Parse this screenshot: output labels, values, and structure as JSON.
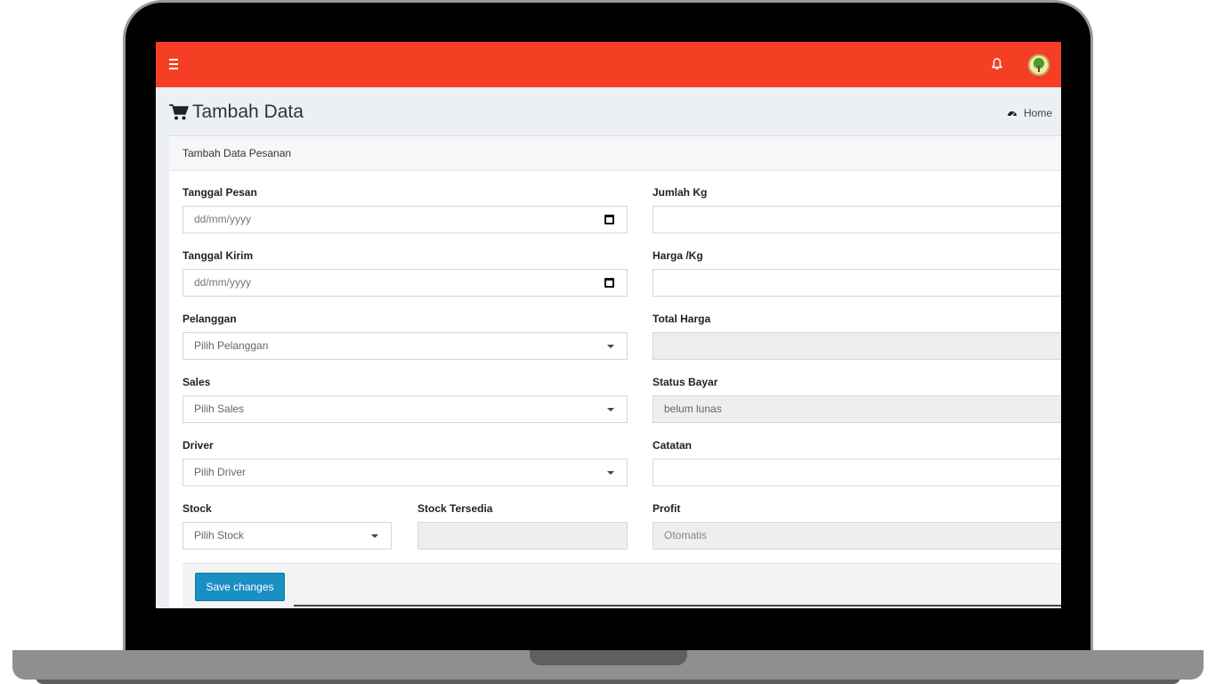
{
  "navbar": {
    "menu_icon": "hamburger-icon",
    "notification_icon": "bell-icon",
    "avatar_icon": "tree-logo-icon",
    "color": "#f43f25"
  },
  "header": {
    "title_icon": "shopping-cart-icon",
    "title": "Tambah Data",
    "breadcrumb_icon": "dashboard-icon",
    "breadcrumb": "Home"
  },
  "form": {
    "title": "Tambah Data Pesanan",
    "tanggal_pesan": {
      "label": "Tanggal Pesan",
      "value": "dd/mm/yyyy"
    },
    "tanggal_kirim": {
      "label": "Tanggal Kirim",
      "value": "dd/mm/yyyy"
    },
    "pelanggan": {
      "label": "Pelanggan",
      "value": "Pilih Pelanggan"
    },
    "sales": {
      "label": "Sales",
      "value": "Pilih Sales"
    },
    "driver": {
      "label": "Driver",
      "value": "Pilih Driver"
    },
    "stock": {
      "label": "Stock",
      "value": "Pilih Stock"
    },
    "stock_tersedia": {
      "label": "Stock Tersedia",
      "value": ""
    },
    "jumlah_kg": {
      "label": "Jumlah Kg",
      "value": ""
    },
    "harga_kg": {
      "label": "Harga /Kg",
      "value": ""
    },
    "total_harga": {
      "label": "Total Harga",
      "value": ""
    },
    "status_bayar": {
      "label": "Status Bayar",
      "value": "belum lunas"
    },
    "catatan": {
      "label": "Catatan",
      "value": ""
    },
    "profit": {
      "label": "Profit",
      "value": "Otomatis"
    },
    "save_label": "Save changes",
    "button_color": "#1a8fc2"
  }
}
